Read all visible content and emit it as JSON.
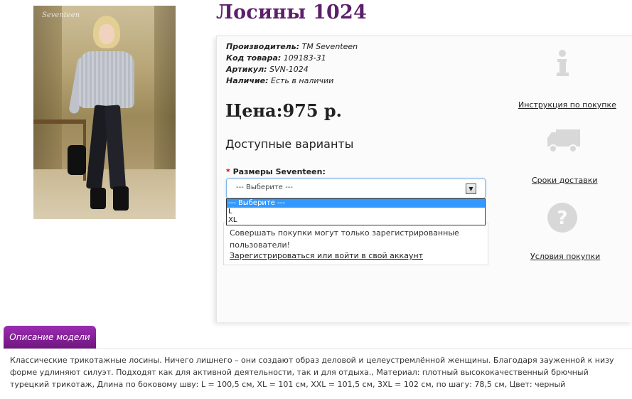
{
  "product": {
    "title": "Лосины 1024",
    "photo_watermark": "Seventeen"
  },
  "meta": {
    "manufacturer_label": "Производитель:",
    "manufacturer_value": "TM Seventeen",
    "code_label": "Код товара:",
    "code_value": "109183-31",
    "article_label": "Артикул:",
    "article_value": "SVN-1024",
    "stock_label": "Наличие:",
    "stock_value": "Есть в наличии"
  },
  "price": "Цена:975 р.",
  "options": {
    "heading": "Доступные варианты",
    "required_mark": "*",
    "size_label": "Размеры Seventeen:",
    "select_value": "--- Выберите ---",
    "dropdown_options": [
      "--- Выберите ---",
      "L",
      "XL"
    ]
  },
  "notice": {
    "message": "Совершать покупки могут только зарегистрированные пользователи!",
    "login_link": "Зарегистрироваться или войти в свой аккаунт"
  },
  "side_links": {
    "instructions": "Инструкция по покупке",
    "delivery": "Сроки доставки",
    "terms": "Условия покупки"
  },
  "icons": {
    "instructions": "info-icon",
    "delivery": "truck-icon",
    "terms": "question-icon",
    "color": "#d8d8d8"
  },
  "description": {
    "tab_label": "Описание модели",
    "text": "Классические трикотажные лосины. Ничего лишнего – они создают образ деловой и целеустремлённой женщины. Благодаря зауженной к низу форме удлиняют силуэт. Подходят как для активной деятельности, так и для отдыха., Материал: плотный высококачественный брючный турецкий трикотаж, Длина по боковому шву: L = 100,5 см, XL = 101 см, XXL = 101,5 см, 3XL = 102 см, по шагу: 78,5 см, Цвет: черный"
  },
  "colors": {
    "title": "#5b1f6a",
    "tab": "#8a229d",
    "dropdown_highlight": "#3399ff"
  }
}
